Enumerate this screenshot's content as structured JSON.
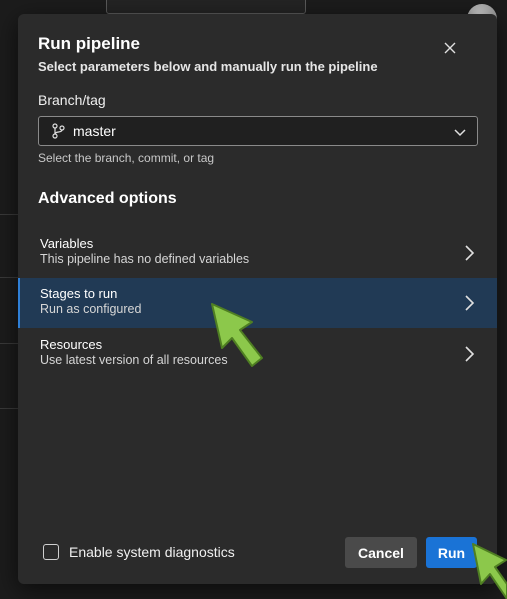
{
  "dialog": {
    "title": "Run pipeline",
    "subtitle": "Select parameters below and manually run the pipeline",
    "close_icon": "close-icon"
  },
  "branch": {
    "label": "Branch/tag",
    "value": "master",
    "icon": "git-branch-icon",
    "helper": "Select the branch, commit, or tag"
  },
  "advanced": {
    "title": "Advanced options",
    "options": [
      {
        "label": "Variables",
        "description": "This pipeline has no defined variables",
        "selected": false
      },
      {
        "label": "Stages to run",
        "description": "Run as configured",
        "selected": true
      },
      {
        "label": "Resources",
        "description": "Use latest version of all resources",
        "selected": false
      }
    ]
  },
  "footer": {
    "diagnostics_label": "Enable system diagnostics",
    "diagnostics_checked": false,
    "cancel_label": "Cancel",
    "run_label": "Run"
  },
  "colors": {
    "dialog_bg": "#2b2b2b",
    "selected_row": "#213a55",
    "primary_button": "#1a73d6",
    "annotation_arrow": "#8cc84b"
  }
}
